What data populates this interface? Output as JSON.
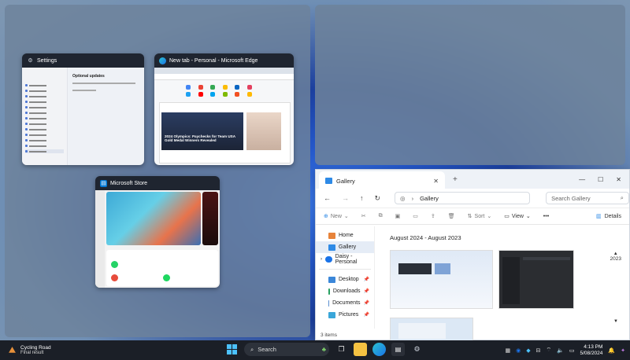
{
  "desktop": {
    "settings_title": "Settings",
    "settings_page": "Optional updates",
    "edge_title": "New tab - Personal - Microsoft Edge",
    "edge_headline": "2024 Olympics: Paychecks for Team USA Gold Medal Winners Revealed",
    "store_title": "Microsoft Store"
  },
  "explorer": {
    "tab_title": "Gallery",
    "address": "Gallery",
    "search_placeholder": "Search Gallery",
    "cmd_new": "New",
    "cmd_sort": "Sort",
    "cmd_view": "View",
    "cmd_more": "•••",
    "cmd_details": "Details",
    "sidebar": [
      {
        "label": "Home",
        "icon": "home-icon"
      },
      {
        "label": "Gallery",
        "icon": "gallery-icon",
        "selected": true
      },
      {
        "label": "Daisy - Personal",
        "icon": "onedrive-icon"
      },
      {
        "label": "Desktop",
        "icon": "desktop-folder-icon"
      },
      {
        "label": "Downloads",
        "icon": "downloads-folder-icon"
      },
      {
        "label": "Documents",
        "icon": "documents-folder-icon"
      },
      {
        "label": "Pictures",
        "icon": "pictures-folder-icon"
      }
    ],
    "date_range": "August 2024 - August 2023",
    "year_marker": "2023",
    "status": "3 items"
  },
  "taskbar": {
    "weather_title": "Cycling Road",
    "weather_sub": "Final result",
    "search_label": "Search",
    "time": "4:13 PM",
    "date": "5/08/2024"
  },
  "colors": {
    "accent": "#0f6cbd",
    "taskbar": "#1b1f27",
    "snap_zone": "#6e829b"
  }
}
